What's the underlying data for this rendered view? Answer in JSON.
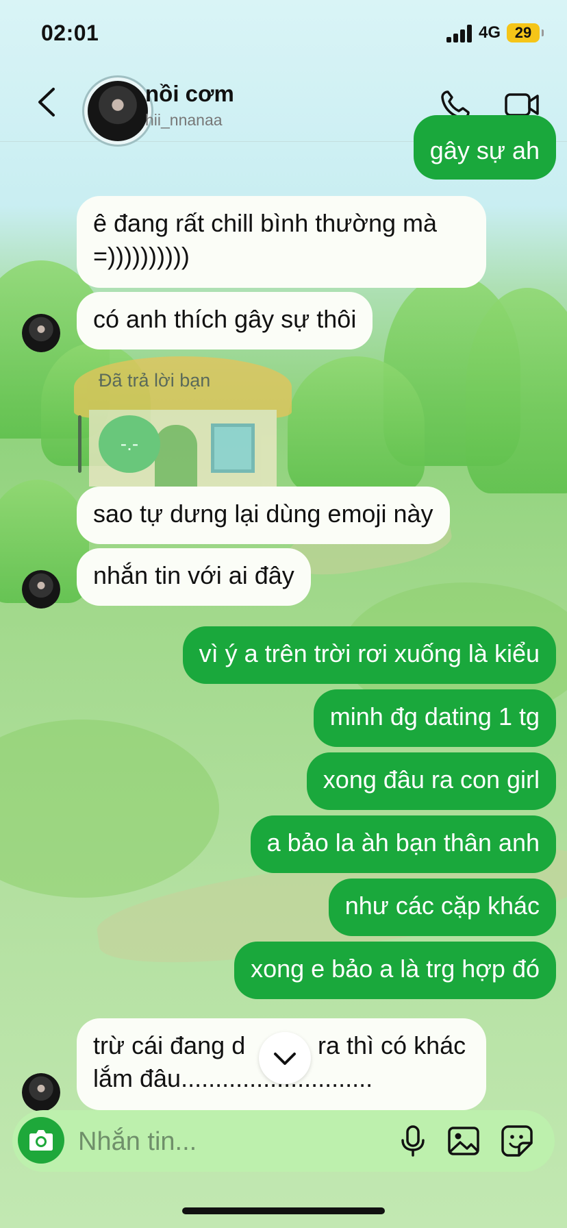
{
  "status": {
    "time": "02:01",
    "network": "4G",
    "battery": "29"
  },
  "header": {
    "back_label": "‹",
    "name": "nồi cơm",
    "username": "hii_nnanaa"
  },
  "messages": {
    "m0": "gây sự ah",
    "m1": "ê đang rất chill bình thường mà =))))))))))",
    "m2": "có anh thích gây sự thôi",
    "reply_label": "Đã trả lời bạn",
    "reply_emoji": "-.-",
    "m3": "sao tự dưng lại dùng emoji này",
    "m4": "nhắn tin với ai đây",
    "m5": "vì ý a trên trời rơi xuống là kiểu",
    "m6": "minh đg dating 1 tg",
    "m7": "xong đâu ra con girl",
    "m8": "a bảo la àh bạn thân anh",
    "m9": "như các cặp khác",
    "m10": "xong e bảo a là trg hợp đó",
    "m11_line1": "trừ cái đang d",
    "m11_line1b": "ra thì có khác",
    "m11_line2": "lắm đâu............................"
  },
  "composer": {
    "placeholder": "Nhắn tin..."
  },
  "colors": {
    "outgoing_bubble": "#1aa83c",
    "incoming_bubble": "#fbfdf7",
    "accent": "#1ea83a"
  }
}
